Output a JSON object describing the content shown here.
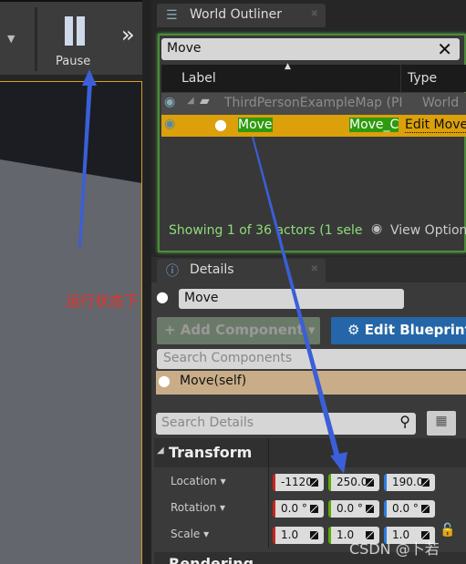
{
  "toolbar": {
    "pause_label": "Pause",
    "pause_icon": "pause-icon",
    "more_icon": "chevrons-right-icon",
    "dropdown_icon": "caret-down-icon"
  },
  "outliner": {
    "title": "World Outliner",
    "search_value": "Move",
    "col_label": "Label",
    "col_type": "Type",
    "rows": [
      {
        "label": "ThirdPersonExampleMap (PI",
        "type": "World"
      },
      {
        "label": "Move",
        "type": "Move_C",
        "action": "Edit Move"
      }
    ],
    "status": "Showing 1 of 36 actors (1 sele",
    "view_options": "View Option"
  },
  "details": {
    "title": "Details",
    "name_value": "Move",
    "add_component": "+ Add Component ▾",
    "edit_blueprint": "Edit Blueprint",
    "search_components_placeholder": "Search Components",
    "component": "Move(self)",
    "search_details_placeholder": "Search Details",
    "section": "Transform",
    "section_next": "Rendering",
    "location_label": "Location",
    "rotation_label": "Rotation",
    "scale_label": "Scale",
    "location": [
      "-1120",
      "250.0",
      "190.0"
    ],
    "rotation": [
      "0.0 °",
      "0.0 °",
      "0.0 °"
    ],
    "scale": [
      "1.0",
      "1.0",
      "1.0"
    ]
  },
  "annotation": {
    "text": "运行状态下",
    "color": "#e8302a",
    "arrow_color": "#3a5fd8"
  },
  "watermark": "CSDN @卜若"
}
